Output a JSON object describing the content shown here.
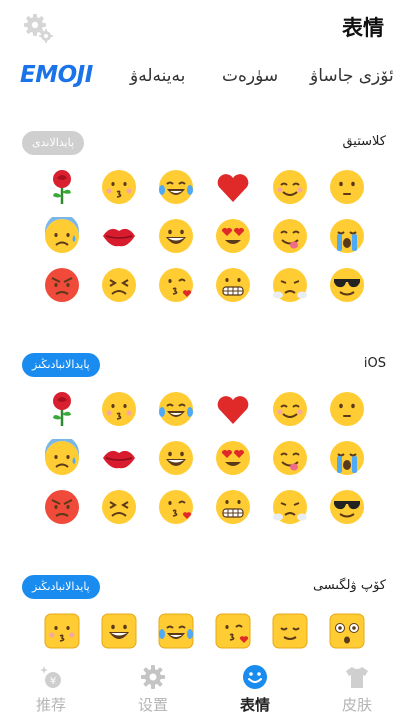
{
  "header": {
    "title": "表情",
    "settings_icon": "gear-icon"
  },
  "category_tabs": [
    {
      "label": "EMOJI",
      "active": true
    },
    {
      "label": "بەينەلەۋ"
    },
    {
      "label": "سۈرەت"
    },
    {
      "label": "ئۆزى جاساۋ"
    }
  ],
  "sections": [
    {
      "name": "كلاستيق",
      "button": "پايدالاندى",
      "button_state": "used",
      "style": "classic",
      "emojis": [
        "rose-icon",
        "kissing-face-icon",
        "tears-of-joy-face-icon",
        "red-heart-icon",
        "smiling-face-icon",
        "neutral-face-icon",
        "cold-sweat-face-icon",
        "kiss-lips-icon",
        "grinning-face-icon",
        "heart-eyes-face-icon",
        "savoring-face-icon",
        "crying-face-icon",
        "angry-face-icon",
        "persevering-face-icon",
        "blowing-kiss-face-icon",
        "grimacing-face-icon",
        "triumph-face-icon",
        "sunglasses-face-icon"
      ]
    },
    {
      "name": "iOS",
      "button": "پايدالانبادىڭىز",
      "button_state": "unused",
      "style": "ios",
      "emojis": [
        "rose-icon",
        "kissing-face-icon",
        "tears-of-joy-face-icon",
        "red-heart-icon",
        "smiling-face-icon",
        "neutral-face-icon",
        "cold-sweat-face-icon",
        "kiss-lips-icon",
        "grinning-face-icon",
        "heart-eyes-face-icon",
        "savoring-face-icon",
        "crying-face-icon",
        "angry-face-icon",
        "persevering-face-icon",
        "blowing-kiss-face-icon",
        "grimacing-face-icon",
        "triumph-face-icon",
        "sunglasses-face-icon"
      ]
    },
    {
      "name": "كۆپ ۋلگىسى",
      "button": "پايدالانبادىڭىز",
      "button_state": "unused",
      "style": "square",
      "emojis": [
        "kissing-face-icon",
        "grinning-face-icon",
        "tears-of-joy-face-icon",
        "blowing-kiss-face-icon",
        "relieved-face-icon",
        "astonished-face-icon"
      ]
    }
  ],
  "bottom_nav": [
    {
      "label": "推荐",
      "icon": "gift-sparkle-icon",
      "active": false
    },
    {
      "label": "设置",
      "icon": "gear-icon",
      "active": false
    },
    {
      "label": "表情",
      "icon": "smiley-icon",
      "active": true
    },
    {
      "label": "皮肤",
      "icon": "tshirt-icon",
      "active": false
    }
  ],
  "colors": {
    "accent": "#1a8cf0",
    "emoji_yellow": "#ffcc33",
    "inactive": "#b5b5b5"
  }
}
